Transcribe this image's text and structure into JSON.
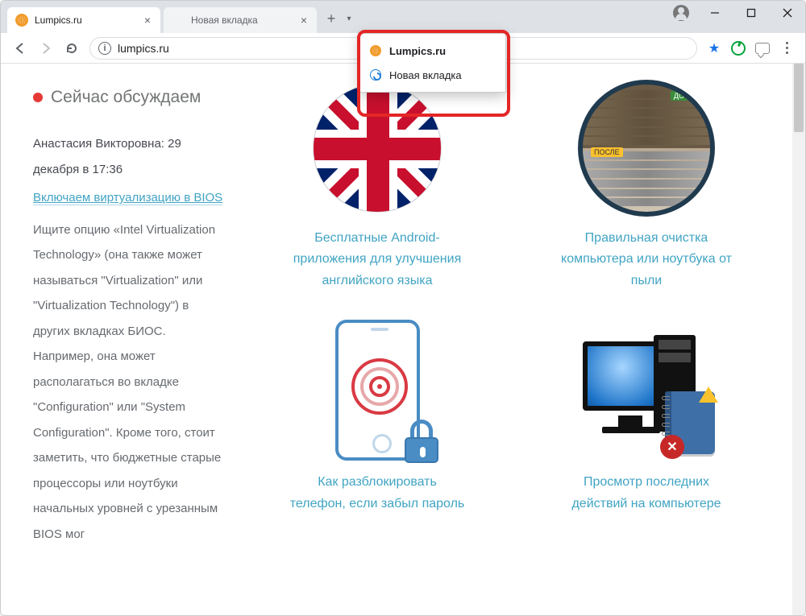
{
  "tabs": [
    {
      "title": "Lumpics.ru",
      "active": true,
      "favicon": "fav-orange"
    },
    {
      "title": "Новая вкладка",
      "active": false,
      "favicon": ""
    }
  ],
  "tabs_dropdown": [
    {
      "title": "Lumpics.ru",
      "bold": true,
      "favicon": "fav-orange"
    },
    {
      "title": "Новая вкладка",
      "bold": false,
      "favicon": "fav-blue"
    }
  ],
  "address_url": "lumpics.ru",
  "sidebar": {
    "heading": "Сейчас обсуждаем",
    "author_time": "Анастасия Викторовна: 29 декабря в 17:36",
    "link_text": "Включаем виртуализацию в BIOS",
    "body": "Ищите опцию «Intel Virtualization Technology» (она также может называться \"Virtualization\" или \"Virtualization Technology\") в других вкладках БИОС. Например, она может располагаться во вкладке \"Configuration\" или \"System Configuration\". Кроме того, стоит заметить, что бюджетные старые процессоры или ноутбуки начальных уровней с урезанным BIOS мог"
  },
  "cards": [
    {
      "caption": "Бесплатные Android-приложения для улучшения английского языка"
    },
    {
      "caption": "Правильная очистка компьютера или ноутбука от пыли",
      "badge_before": "ДО",
      "badge_after": "ПОСЛЕ"
    },
    {
      "caption": "Как разблокировать телефон, если забыл пароль"
    },
    {
      "caption": "Просмотр последних действий на компьютере"
    }
  ]
}
